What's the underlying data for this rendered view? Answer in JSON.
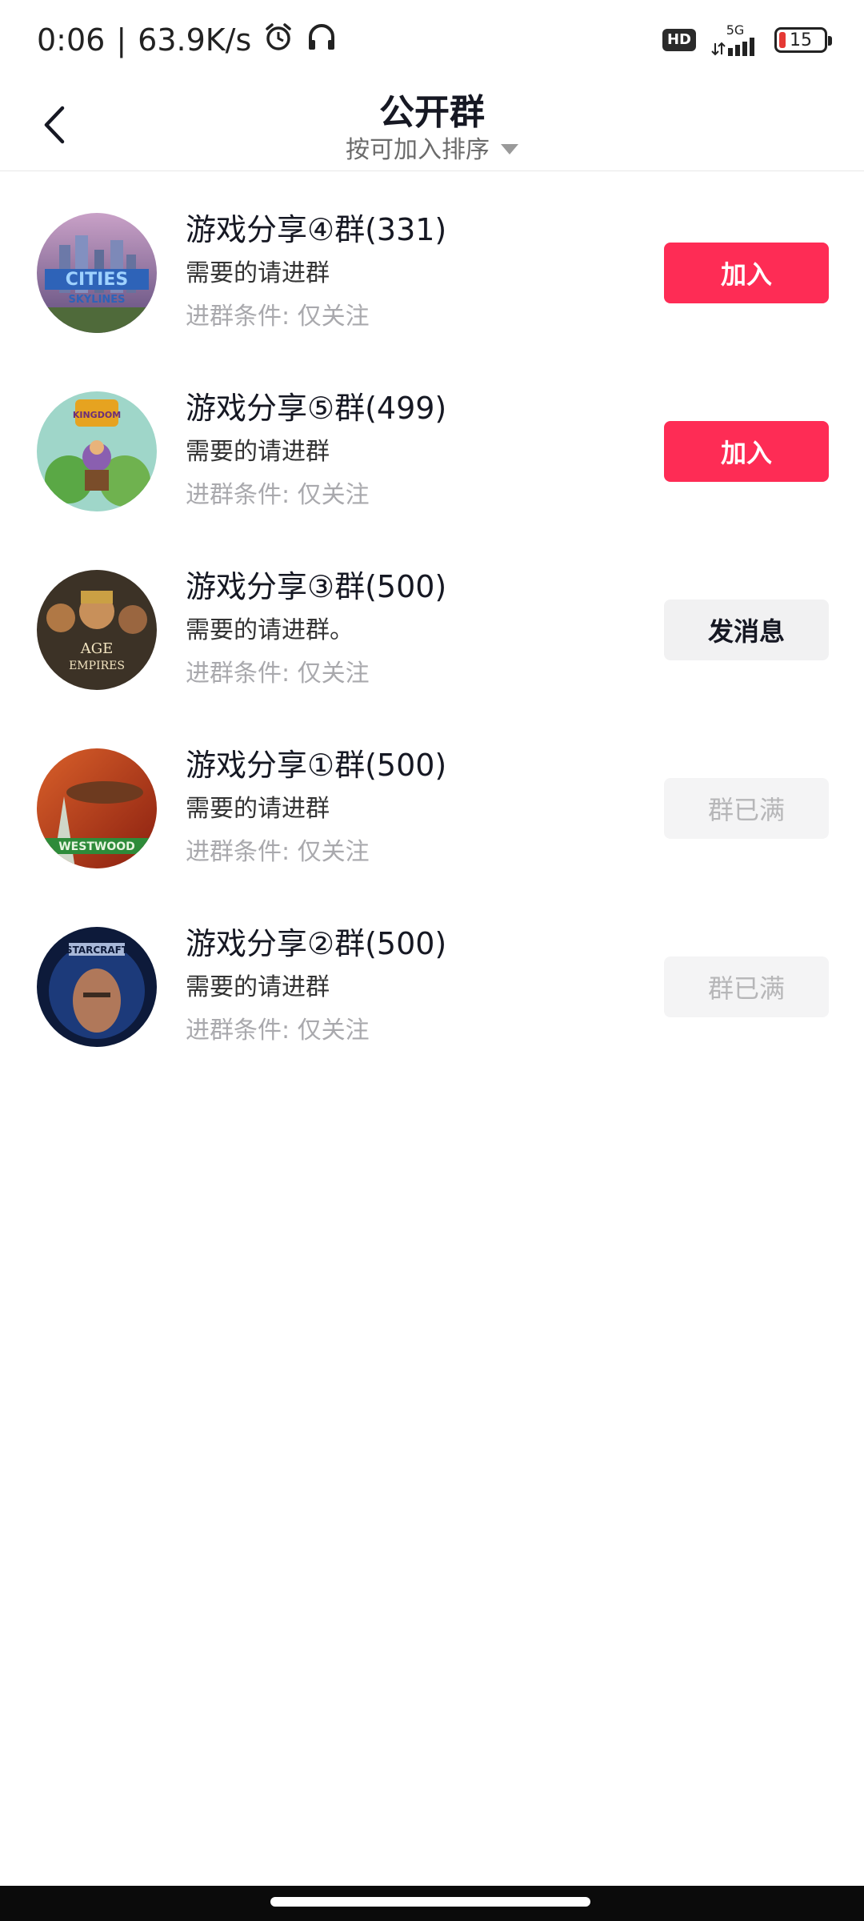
{
  "status_bar": {
    "time": "0:06",
    "speed": "63.9K/s",
    "hd": "HD",
    "network": "5G",
    "battery": "15"
  },
  "header": {
    "title": "公开群",
    "sort_label": "按可加入排序"
  },
  "groups": [
    {
      "name": "游戏分享④群(331)",
      "desc": "需要的请进群",
      "condition": "进群条件: 仅关注",
      "action": "加入",
      "action_type": "join",
      "avatar": "cities-skylines-avatar"
    },
    {
      "name": "游戏分享⑤群(499)",
      "desc": "需要的请进群",
      "condition": "进群条件: 仅关注",
      "action": "加入",
      "action_type": "join",
      "avatar": "kingdom-rush-avatar"
    },
    {
      "name": "游戏分享③群(500)",
      "desc": "需要的请进群。",
      "condition": "进群条件: 仅关注",
      "action": "发消息",
      "action_type": "message",
      "avatar": "age-of-empires-avatar"
    },
    {
      "name": "游戏分享①群(500)",
      "desc": "需要的请进群",
      "condition": "进群条件: 仅关注",
      "action": "群已满",
      "action_type": "full",
      "avatar": "westwood-avatar"
    },
    {
      "name": "游戏分享②群(500)",
      "desc": "需要的请进群",
      "condition": "进群条件: 仅关注",
      "action": "群已满",
      "action_type": "full",
      "avatar": "starcraft-avatar"
    }
  ],
  "colors": {
    "accent": "#fe2c55",
    "text": "#161823",
    "muted": "#a9a9ad"
  }
}
